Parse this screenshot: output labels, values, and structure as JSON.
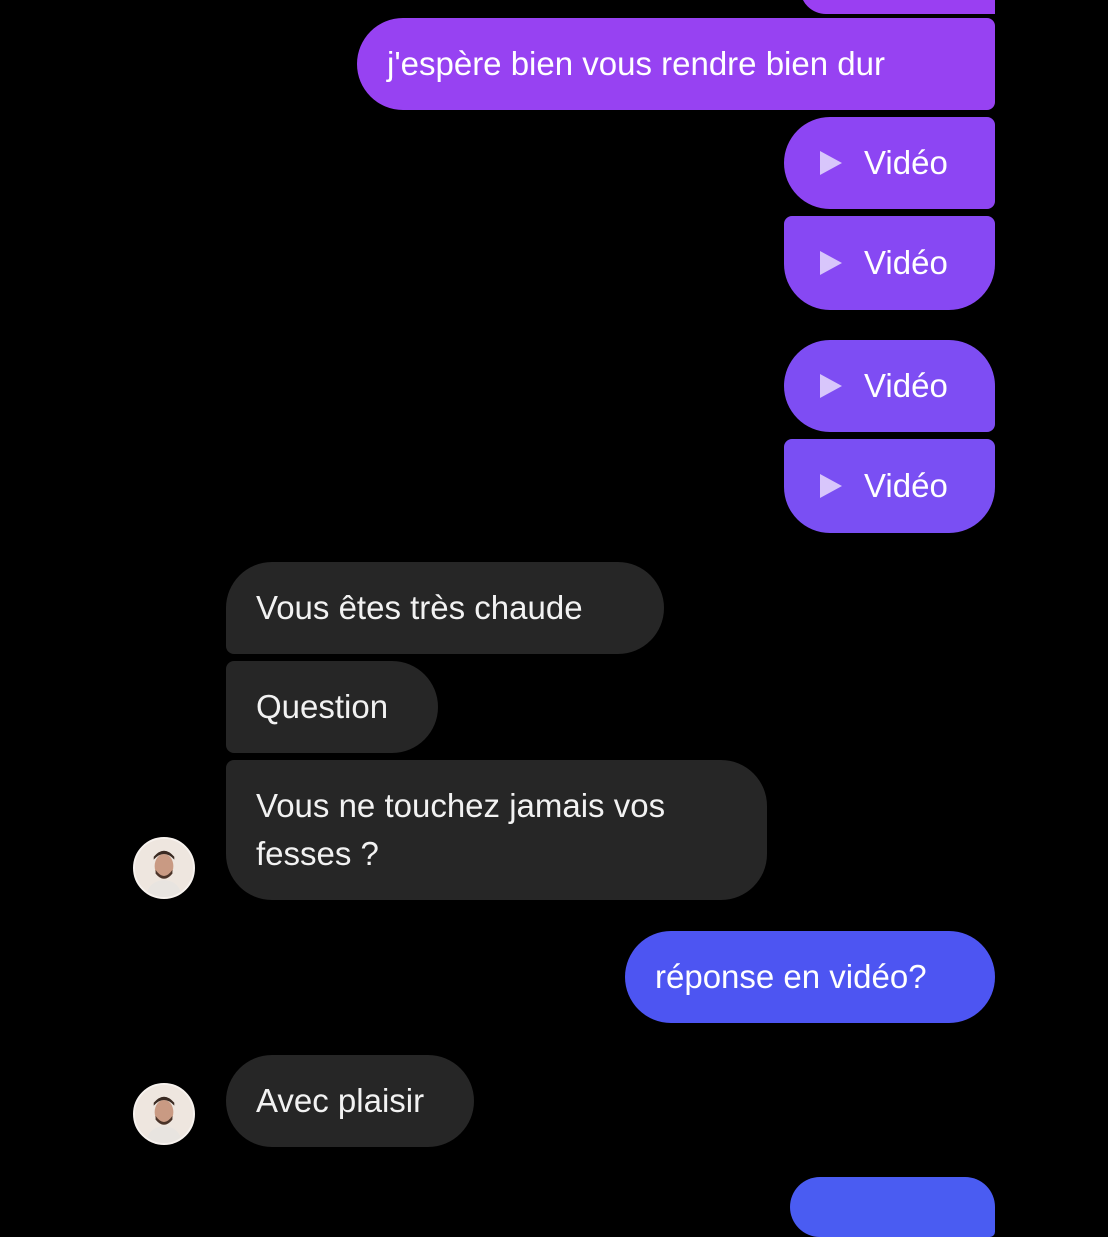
{
  "conversation": {
    "messages": [
      {
        "sender": "me",
        "type": "text",
        "text": "j'espère bien vous rendre bien dur"
      },
      {
        "sender": "me",
        "type": "video",
        "label": "Vidéo"
      },
      {
        "sender": "me",
        "type": "video",
        "label": "Vidéo"
      },
      {
        "sender": "me",
        "type": "video",
        "label": "Vidéo"
      },
      {
        "sender": "me",
        "type": "video",
        "label": "Vidéo"
      },
      {
        "sender": "them",
        "type": "text",
        "text": "Vous êtes très chaude"
      },
      {
        "sender": "them",
        "type": "text",
        "text": "Question"
      },
      {
        "sender": "them",
        "type": "text",
        "text": "Vous ne touchez jamais vos fesses ?"
      },
      {
        "sender": "me",
        "type": "text",
        "text": "réponse en vidéo?"
      },
      {
        "sender": "them",
        "type": "text",
        "text": "Avec plaisir"
      }
    ]
  },
  "colors": {
    "background": "#000000",
    "sent_bubble_purple": "#8a46f0",
    "sent_bubble_blue": "#4a55f0",
    "received_bubble": "#262626"
  },
  "icons": {
    "play": "play-icon",
    "avatar": "contact-avatar"
  }
}
